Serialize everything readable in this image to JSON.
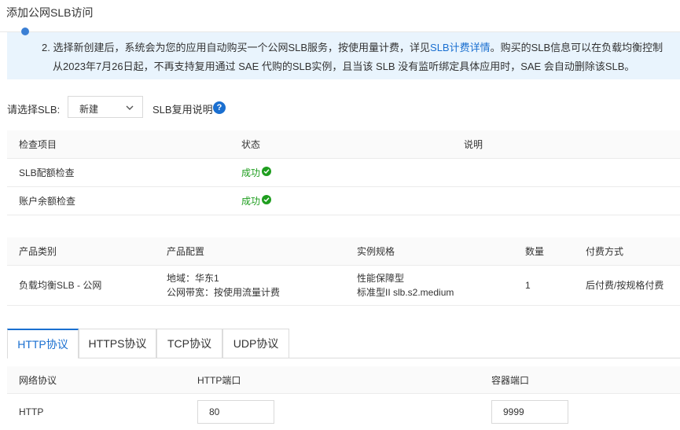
{
  "dialog": {
    "title": "添加公网SLB访问"
  },
  "notice": {
    "line1_prefix": "2. 选择新创建后，系统会为您的应用自动购买一个公网SLB服务，按使用量计费，详见",
    "line1_link": "SLB计费详情",
    "line1_suffix": "。购买的SLB信息可以在负载均衡控制",
    "line2": "从2023年7月26日起，不再支持复用通过 SAE 代购的SLB实例，且当该 SLB 没有监听绑定具体应用时，SAE 会自动删除该SLB。"
  },
  "slb_select": {
    "label": "请选择SLB:",
    "value": "新建",
    "reuse_label": "SLB复用说明",
    "help": "?"
  },
  "check_table": {
    "headers": [
      "检查项目",
      "状态",
      "说明"
    ],
    "rows": [
      {
        "item": "SLB配额检查",
        "status": "成功",
        "desc": ""
      },
      {
        "item": "账户余额检查",
        "status": "成功",
        "desc": ""
      }
    ]
  },
  "product_table": {
    "headers": [
      "产品类别",
      "产品配置",
      "实例规格",
      "数量",
      "付费方式"
    ],
    "row": {
      "category": "负载均衡SLB - 公网",
      "config_line1": "地域：华东1",
      "config_line2": "公网带宽：按使用流量计费",
      "spec_line1": "性能保障型",
      "spec_line2": "标准型II slb.s2.medium",
      "quantity": "1",
      "billing": "后付费/按规格付费"
    }
  },
  "tabs": [
    {
      "label": "HTTP协议",
      "active": true
    },
    {
      "label": "HTTPS协议",
      "active": false
    },
    {
      "label": "TCP协议",
      "active": false
    },
    {
      "label": "UDP协议",
      "active": false
    }
  ],
  "protocol_table": {
    "headers": [
      "网络协议",
      "HTTP端口",
      "容器端口"
    ],
    "row": {
      "protocol": "HTTP",
      "http_port": "80",
      "container_port": "9999"
    }
  },
  "colors": {
    "accent": "#1a6fd0",
    "success": "#1f9e1f",
    "notice_bg": "#e9f4fd"
  }
}
